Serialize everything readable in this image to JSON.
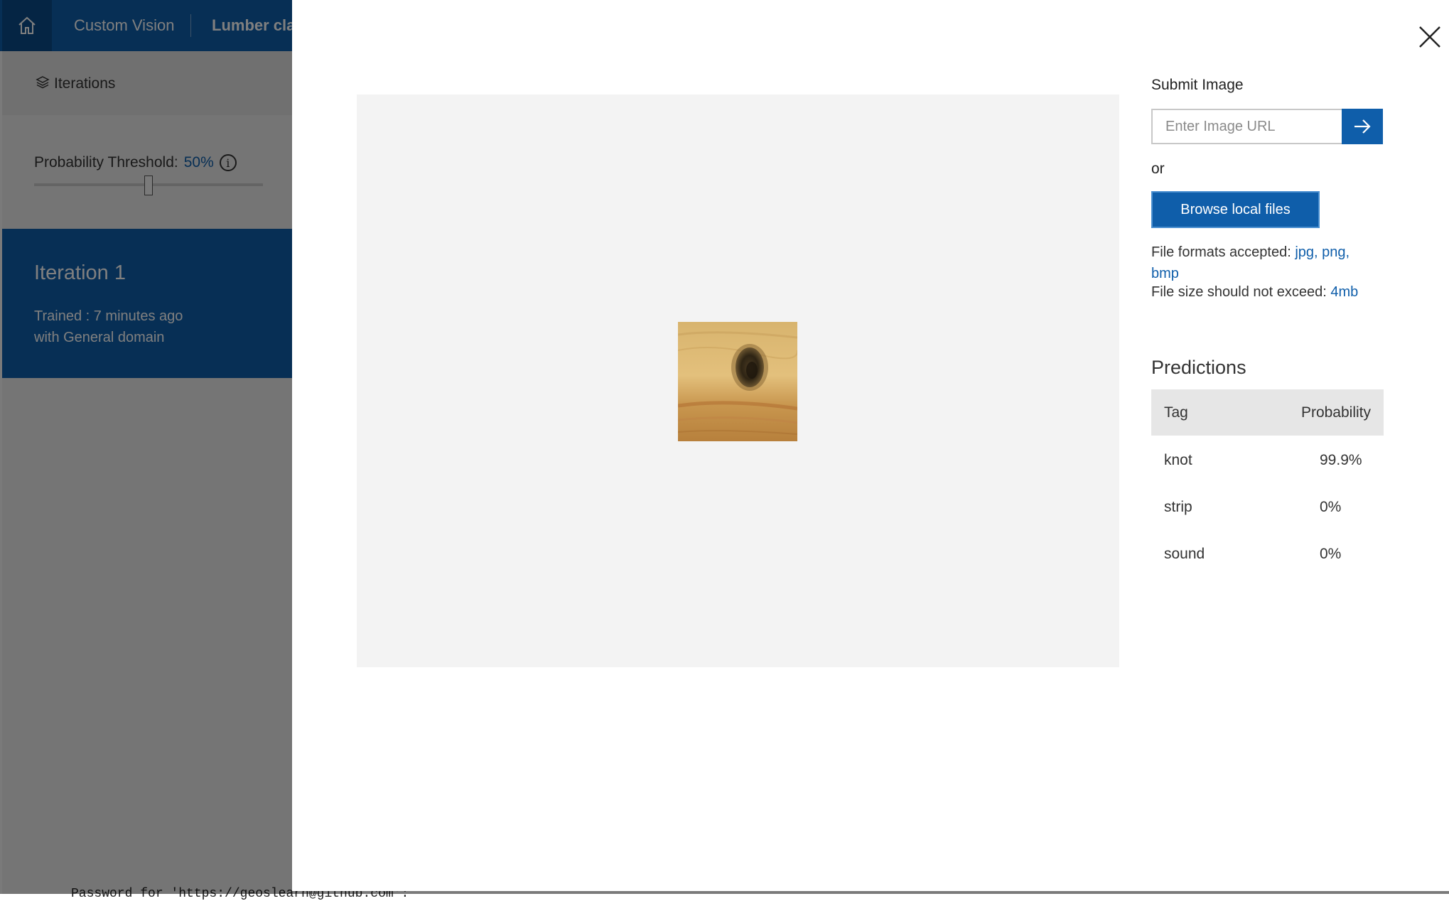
{
  "app": {
    "breadcrumb_service": "Custom Vision",
    "breadcrumb_project": "Lumber clas",
    "iterations_label": "Iterations",
    "threshold_label": "Probability Threshold:",
    "threshold_value": "50%",
    "threshold_fraction": 0.5,
    "iteration_name": "Iteration 1",
    "iteration_trained": "Trained : 7 minutes ago",
    "iteration_domain": "with General domain",
    "bottom_text": "Password for 'https://geoslearn@github.com':"
  },
  "dialog": {
    "submit_title": "Submit Image",
    "url_placeholder": "Enter Image URL",
    "or_text": "or",
    "browse_label": "Browse local files",
    "formats_label": "File formats accepted:",
    "formats_value": "jpg, png, bmp",
    "size_label": "File size should not exceed:",
    "size_value": "4mb",
    "predictions_title": "Predictions",
    "col_tag": "Tag",
    "col_probability": "Probability",
    "predictions": [
      {
        "tag": "knot",
        "probability": "99.9%"
      },
      {
        "tag": "strip",
        "probability": "0%"
      },
      {
        "tag": "sound",
        "probability": "0%"
      }
    ]
  },
  "colors": {
    "accent": "#0f5eaa",
    "preview_bg": "#f3f3f3"
  },
  "icons": [
    "home-icon",
    "layers-icon",
    "info-icon",
    "arrow-right-icon",
    "close-icon"
  ]
}
